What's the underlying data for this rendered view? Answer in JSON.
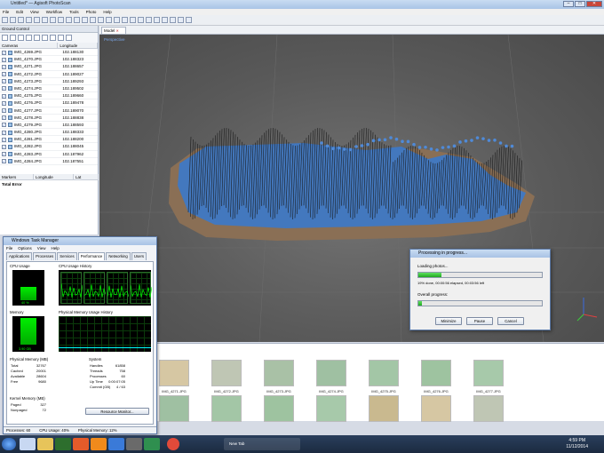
{
  "app": {
    "title": "Untitled* — Agisoft PhotoScan",
    "menu": [
      "File",
      "Edit",
      "View",
      "Workflow",
      "Tools",
      "Photo",
      "Help"
    ]
  },
  "left_panel": {
    "title": "Ground Control",
    "columns": [
      "Cameras",
      "Longitude"
    ],
    "cameras": [
      {
        "name": "IMG_4269.JPG",
        "lon": "102.188130"
      },
      {
        "name": "IMG_4270.JPG",
        "lon": "102.188323"
      },
      {
        "name": "IMG_4271.JPG",
        "lon": "102.188657"
      },
      {
        "name": "IMG_4272.JPG",
        "lon": "102.189027"
      },
      {
        "name": "IMG_4273.JPG",
        "lon": "102.189293"
      },
      {
        "name": "IMG_4274.JPG",
        "lon": "102.189502"
      },
      {
        "name": "IMG_4275.JPG",
        "lon": "102.189660"
      },
      {
        "name": "IMG_4276.JPG",
        "lon": "102.189478"
      },
      {
        "name": "IMG_4277.JPG",
        "lon": "102.189070"
      },
      {
        "name": "IMG_4278.JPG",
        "lon": "102.188838"
      },
      {
        "name": "IMG_4279.JPG",
        "lon": "102.188593"
      },
      {
        "name": "IMG_4280.JPG",
        "lon": "102.188333"
      },
      {
        "name": "IMG_4281.JPG",
        "lon": "102.188200"
      },
      {
        "name": "IMG_4282.JPG",
        "lon": "102.188045"
      },
      {
        "name": "IMG_4283.JPG",
        "lon": "102.187962"
      },
      {
        "name": "IMG_4284.JPG",
        "lon": "102.187551"
      }
    ],
    "marker_columns": [
      "Markers",
      "Longitude",
      "Lat"
    ],
    "total_error": "Total Error"
  },
  "viewport": {
    "tab": "Model",
    "label": "Perspective"
  },
  "photos": {
    "row1": [
      "IMG_4271.JPG",
      "IMG_4271.JPG",
      "IMG_4272.JPG",
      "IMG_4273.JPG",
      "IMG_4274.JPG",
      "IMG_4275.JPG",
      "IMG_4276.JPG",
      "IMG_4277.JPG"
    ],
    "row1_colors": [
      "#c9b98f",
      "#d6c7a3",
      "#bfc6b4",
      "#a9c1a6",
      "#9fc0a2",
      "#a3c6a6",
      "#9ec3a0",
      "#a7c9aa"
    ]
  },
  "task_manager": {
    "title": "Windows Task Manager",
    "menu": [
      "File",
      "Options",
      "View",
      "Help"
    ],
    "tabs": [
      "Applications",
      "Processes",
      "Services",
      "Performance",
      "Networking",
      "Users"
    ],
    "active_tab": "Performance",
    "cpu_usage_label": "CPU Usage",
    "cpu_history_label": "CPU Usage History",
    "cpu_value": "40 %",
    "cpu_fraction": 0.4,
    "memory_label": "Memory",
    "memory_history_label": "Physical Memory Usage History",
    "memory_value": "3.90 GB",
    "memory_fraction": 0.12,
    "physical_memory": {
      "title": "Physical Memory (MB)",
      "rows": [
        [
          "Total",
          "32767"
        ],
        [
          "Cached",
          "20001"
        ],
        [
          "Available",
          "28604"
        ],
        [
          "Free",
          "9680"
        ]
      ]
    },
    "kernel_memory": {
      "title": "Kernel Memory (MB)",
      "rows": [
        [
          "Paged",
          "327"
        ],
        [
          "Nonpaged",
          "72"
        ]
      ]
    },
    "system": {
      "title": "System",
      "rows": [
        [
          "Handles",
          "61858"
        ],
        [
          "Threads",
          "758"
        ],
        [
          "Processes",
          "60"
        ],
        [
          "Up Time",
          "0:00:07:05"
        ],
        [
          "Commit (GB)",
          "4 / 63"
        ]
      ]
    },
    "resource_button": "Resource Monitor...",
    "status": [
      "Processes: 60",
      "CPU Usage: 40%",
      "Physical Memory: 12%"
    ]
  },
  "processing": {
    "title": "Processing in progress...",
    "current_label": "Loading photos...",
    "current_text": "19% done, 00:00:56 elapsed, 00:03:56 left",
    "current_fraction": 0.19,
    "overall_label": "Overall progress:",
    "overall_fraction": 0.03,
    "buttons": [
      "Minimize",
      "Pause",
      "Cancel"
    ]
  },
  "taskbar": {
    "time": "4:59 PM",
    "date": "11/12/2014",
    "window_label": "New Tab"
  }
}
